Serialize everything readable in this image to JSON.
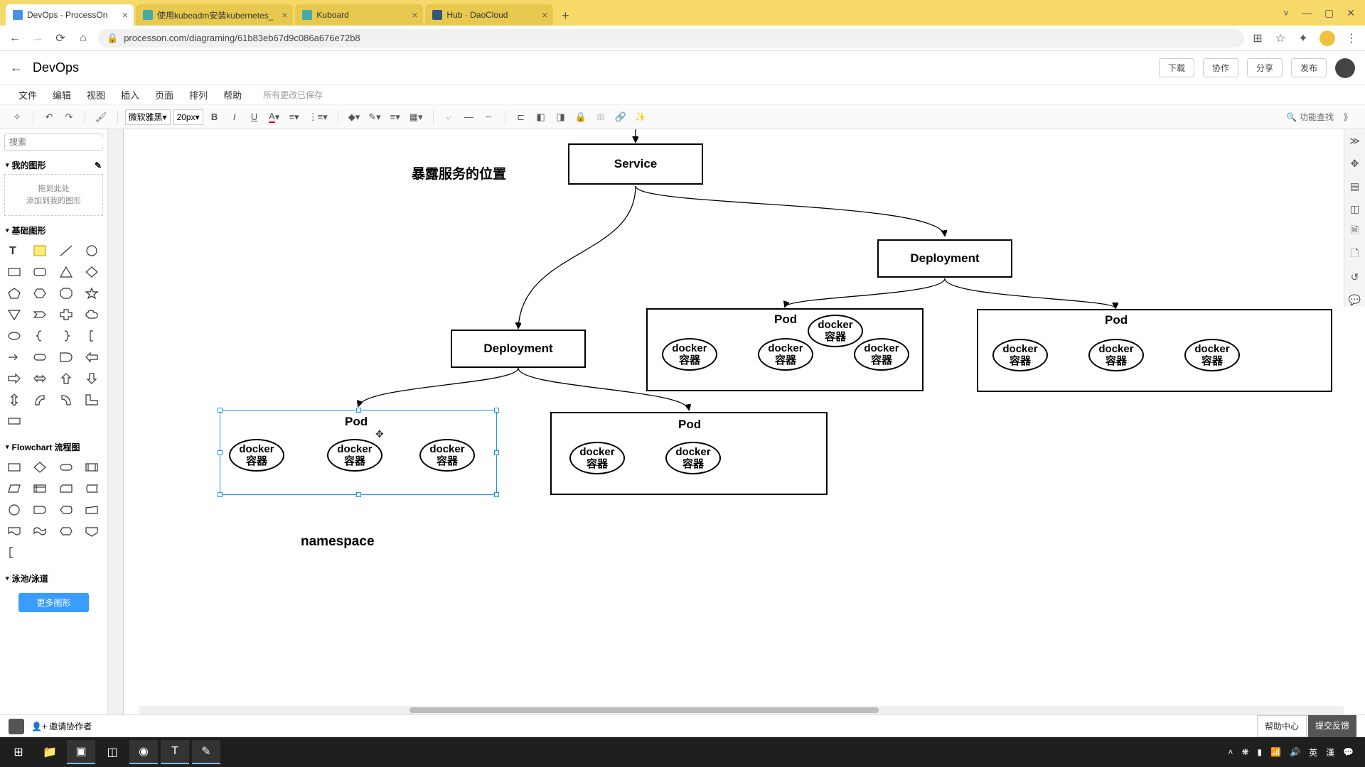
{
  "browser": {
    "tabs": [
      {
        "title": "DevOps - ProcessOn",
        "active": true
      },
      {
        "title": "使用kubeadm安装kubernetes_",
        "active": false
      },
      {
        "title": "Kuboard",
        "active": false
      },
      {
        "title": "Hub · DaoCloud",
        "active": false
      }
    ],
    "url": "processon.com/diagraming/61b83eb67d9c086a676e72b8",
    "win": {
      "min": "—",
      "max": "▢",
      "close": "✕",
      "drop": "˅"
    }
  },
  "app": {
    "back": "←",
    "title": "DevOps",
    "buttons": {
      "download": "下载",
      "collab": "协作",
      "share": "分享",
      "publish": "发布"
    }
  },
  "menu": {
    "items": [
      "文件",
      "编辑",
      "视图",
      "插入",
      "页面",
      "排列",
      "帮助"
    ],
    "status": "所有更改已保存"
  },
  "toolbar": {
    "font": "微软雅黑",
    "size": "20px",
    "search_label": "功能查找"
  },
  "left": {
    "search_ph": "搜索",
    "my_shapes": "我的图形",
    "drop_hint1": "拖到此处",
    "drop_hint2": "添加到我的图形",
    "basic": "基础图形",
    "flowchart": "Flowchart 流程图",
    "swimlane": "泳池/泳道",
    "more": "更多图形"
  },
  "diagram": {
    "service": "Service",
    "deployment": "Deployment",
    "pod": "Pod",
    "docker_l1": "docker",
    "docker_l2": "容器",
    "expose_label": "暴露服务的位置",
    "namespace": "namespace"
  },
  "collab": {
    "invite": "邀请协作者",
    "help": "帮助中心",
    "feedback": "提交反馈"
  },
  "tray": {
    "lang": "英",
    "ime": "漢"
  }
}
